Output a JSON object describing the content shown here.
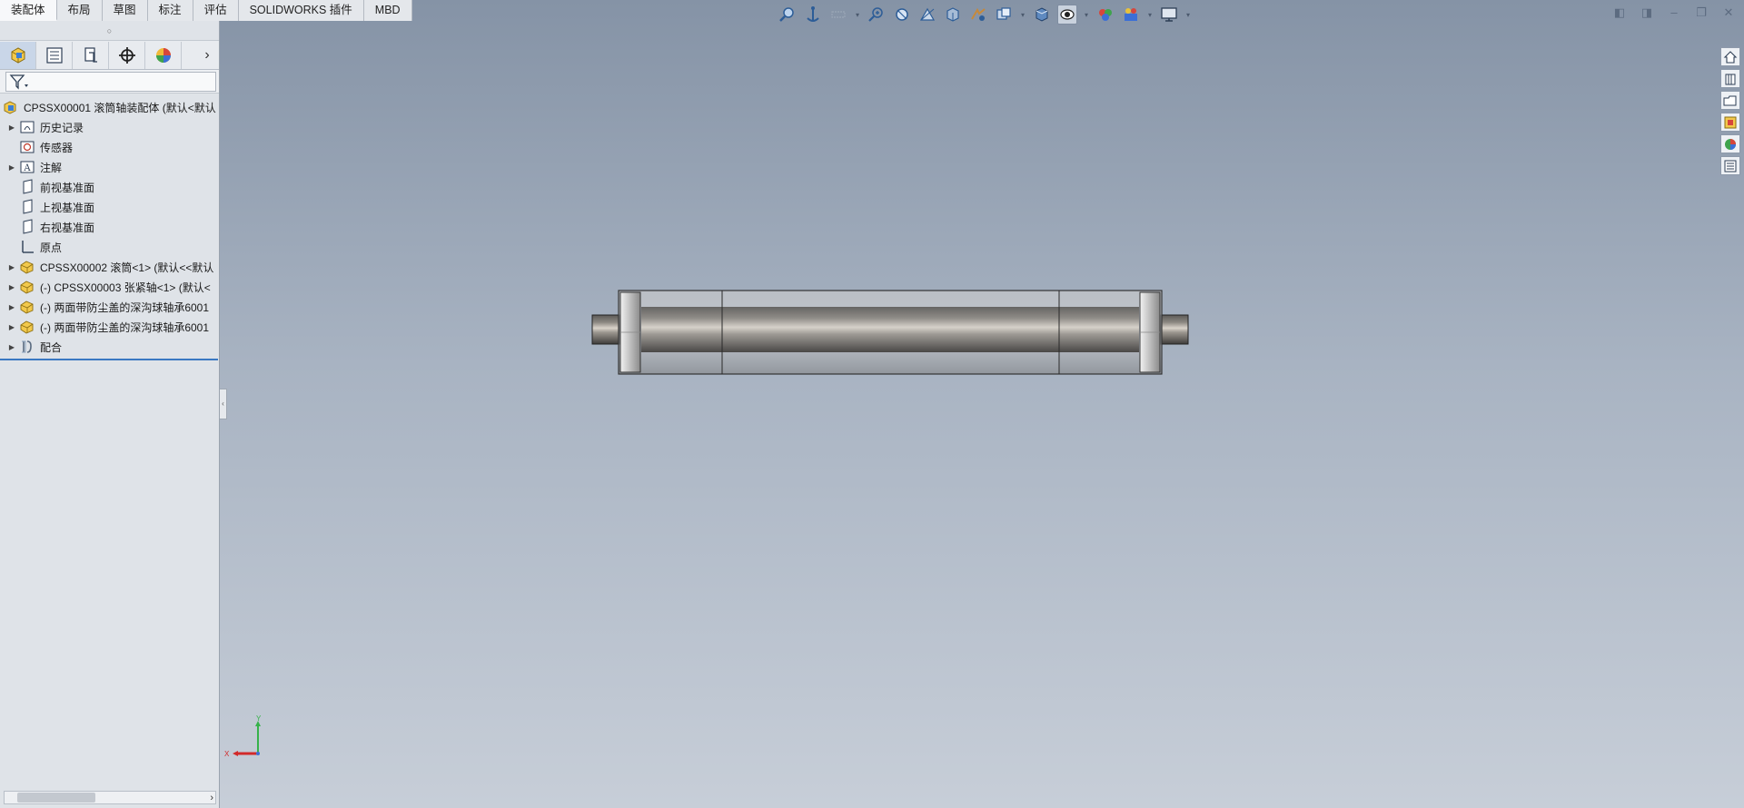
{
  "command_tabs": [
    "装配体",
    "布局",
    "草图",
    "标注",
    "评估",
    "SOLIDWORKS 插件",
    "MBD"
  ],
  "active_tab": "装配体",
  "hud_icons": [
    "zoom-to-fit-icon",
    "zoom-to-area-icon",
    "previous-view-icon",
    "section-view-icon",
    "dynamic-annotation-icon",
    "view-orientation-icon",
    "display-style-icon",
    "hide-show-items-icon",
    "edit-appearance-icon",
    "apply-scene-icon",
    "view-settings-icon"
  ],
  "panel": {
    "tabs": [
      "featuremanager-icon",
      "propertymanager-icon",
      "configurationmanager-icon",
      "dimxpert-icon",
      "displaymanager-icon"
    ],
    "tree": {
      "root": "CPSSX00001 滚筒轴装配体  (默认<默认",
      "items": [
        {
          "label": "历史记录",
          "icon": "history-icon",
          "expandable": true
        },
        {
          "label": "传感器",
          "icon": "sensor-icon",
          "expandable": false
        },
        {
          "label": "注解",
          "icon": "annotation-icon",
          "expandable": true
        },
        {
          "label": "前视基准面",
          "icon": "plane-icon",
          "expandable": false
        },
        {
          "label": "上视基准面",
          "icon": "plane-icon",
          "expandable": false
        },
        {
          "label": "右视基准面",
          "icon": "plane-icon",
          "expandable": false
        },
        {
          "label": "原点",
          "icon": "origin-icon",
          "expandable": false
        },
        {
          "label": "CPSSX00002 滚筒<1> (默认<<默认",
          "icon": "part-icon",
          "expandable": true
        },
        {
          "label": "(-) CPSSX00003 张紧轴<1> (默认<",
          "icon": "part-icon",
          "expandable": true
        },
        {
          "label": "(-) 两面带防尘盖的深沟球轴承6001",
          "icon": "part-icon",
          "expandable": true
        },
        {
          "label": "(-) 两面带防尘盖的深沟球轴承6001",
          "icon": "part-icon",
          "expandable": true
        },
        {
          "label": "配合",
          "icon": "mates-icon",
          "expandable": true
        }
      ]
    }
  },
  "triad": {
    "x_label": "X",
    "y_label": "Y"
  },
  "task_pane": [
    "home-icon",
    "design-library-icon",
    "file-explorer-icon",
    "view-palette-icon",
    "appearances-icon",
    "custom-properties-icon"
  ],
  "colors": {
    "accent": "#3a78c2",
    "viewport_top": "#8593a6",
    "viewport_bottom": "#c7ced8"
  }
}
